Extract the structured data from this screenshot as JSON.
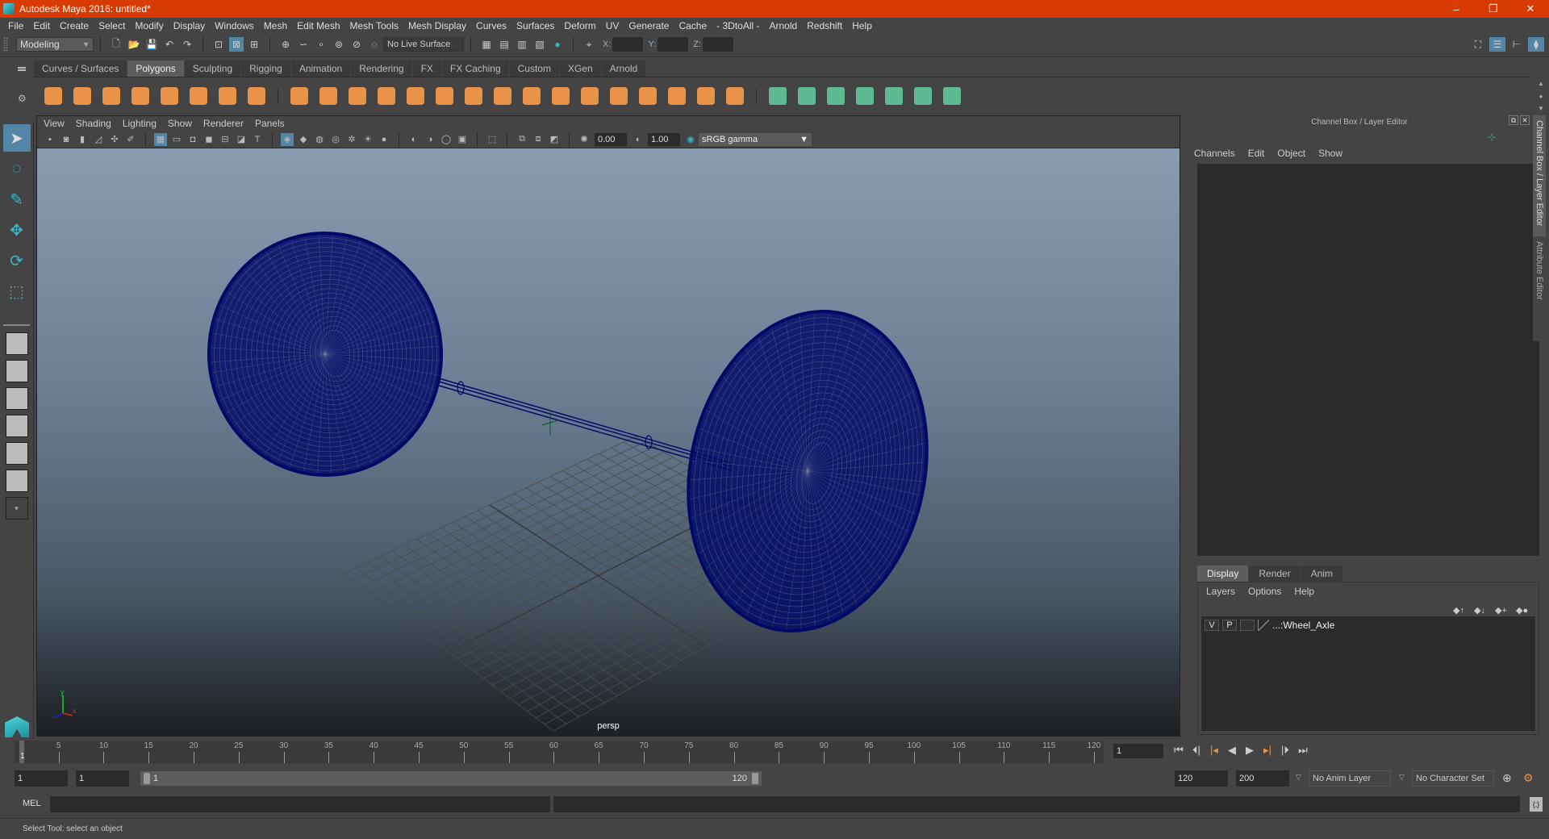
{
  "window": {
    "title": "Autodesk Maya 2016: untitled*",
    "minimize": "–",
    "restore": "❐",
    "close": "✕"
  },
  "menubar": [
    "File",
    "Edit",
    "Create",
    "Select",
    "Modify",
    "Display",
    "Windows",
    "Mesh",
    "Edit Mesh",
    "Mesh Tools",
    "Mesh Display",
    "Curves",
    "Surfaces",
    "Deform",
    "UV",
    "Generate",
    "Cache",
    "- 3DtoAll -",
    "Arnold",
    "Redshift",
    "Help"
  ],
  "statusline": {
    "mode": "Modeling",
    "live_surface": "No Live Surface",
    "x_label": "X:",
    "y_label": "Y:",
    "z_label": "Z:",
    "x_value": "",
    "y_value": "",
    "z_value": ""
  },
  "shelf": {
    "tabs": [
      "Curves / Surfaces",
      "Polygons",
      "Sculpting",
      "Rigging",
      "Animation",
      "Rendering",
      "FX",
      "FX Caching",
      "Custom",
      "XGen",
      "Arnold"
    ],
    "active_tab": "Polygons",
    "orange_icons": [
      "poly-sphere",
      "poly-cube",
      "poly-cylinder",
      "poly-cone",
      "poly-plane",
      "poly-torus",
      "poly-pyramid",
      "poly-pipe",
      "combine",
      "separate",
      "mirror",
      "smooth",
      "extrude",
      "bridge",
      "append",
      "multi-cut",
      "insert-edge-loop",
      "bevel",
      "fill-hole",
      "merge",
      "target-weld",
      "bridge-2",
      "boolean",
      "smooth-proxy"
    ],
    "green_icons": [
      "planar-map",
      "cylindrical-map",
      "spherical-map",
      "automatic-map",
      "unfold",
      "uv-editor",
      "layout-uv"
    ]
  },
  "viewport": {
    "menu": [
      "View",
      "Shading",
      "Lighting",
      "Show",
      "Renderer",
      "Panels"
    ],
    "exposure": "0.00",
    "gamma": "1.00",
    "color_space": "sRGB gamma",
    "camera_label": "persp",
    "wire_color": "#000a66",
    "objects": [
      "wheel-left",
      "wheel-right",
      "axle",
      "ground-grid"
    ]
  },
  "channelbox": {
    "title": "Channel Box / Layer Editor",
    "menu": [
      "Channels",
      "Edit",
      "Object",
      "Show"
    ],
    "layer_tabs": [
      "Display",
      "Render",
      "Anim"
    ],
    "active_layer_tab": "Display",
    "layer_menu": [
      "Layers",
      "Options",
      "Help"
    ],
    "layers": [
      {
        "v": "V",
        "p": "P",
        "name": "...:Wheel_Axle"
      }
    ]
  },
  "side_tabs": [
    "Channel Box / Layer Editor",
    "Attribute Editor"
  ],
  "timeline": {
    "ticks": [
      5,
      10,
      15,
      20,
      25,
      30,
      35,
      40,
      45,
      50,
      55,
      60,
      65,
      70,
      75,
      80,
      85,
      90,
      95,
      100,
      105,
      110,
      115,
      120
    ],
    "current_frame": "1",
    "range_min": 1,
    "range_max": 120
  },
  "range": {
    "start": "1",
    "playback_start": "1",
    "slider_start": "1",
    "slider_end": "120",
    "playback_end": "120",
    "end": "200",
    "anim_layer": "No Anim Layer",
    "character_set": "No Character Set"
  },
  "cmdline": {
    "label": "MEL"
  },
  "helpline": {
    "text": "Select Tool: select an object"
  },
  "accent": {
    "title_bar": "#d83b01",
    "selected": "#5285a6",
    "shelf_orange": "#e8924a",
    "shelf_green": "#5dba92"
  }
}
